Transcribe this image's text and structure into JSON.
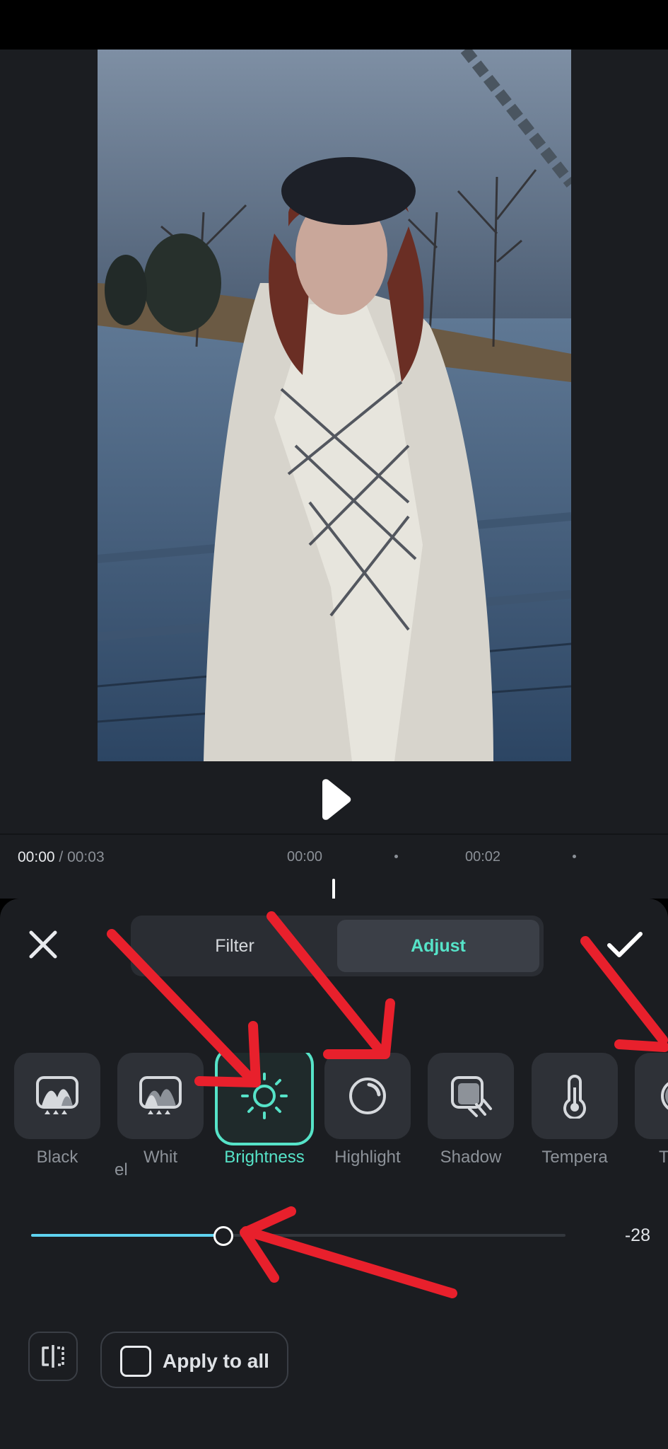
{
  "timeline": {
    "current": "00:00",
    "separator": " / ",
    "total": "00:03",
    "ticks": [
      "00:00",
      "00:02"
    ]
  },
  "tabs": {
    "filter": "Filter",
    "adjust": "Adjust",
    "selected": "Adjust"
  },
  "tools": [
    {
      "label": "el",
      "icon": "levels-icon"
    },
    {
      "label": "Black",
      "icon": "black-point-icon"
    },
    {
      "label": "el",
      "icon": "levels-icon"
    },
    {
      "label": "Whit",
      "icon": "white-point-icon"
    },
    {
      "label": "Brightness",
      "icon": "sun-icon",
      "selected": true
    },
    {
      "label": "Highlight",
      "icon": "highlight-icon"
    },
    {
      "label": "Shadow",
      "icon": "shadow-icon"
    },
    {
      "label": "Tempera",
      "icon": "thermometer-icon"
    },
    {
      "label": "T",
      "icon": "tint-icon"
    }
  ],
  "slider": {
    "value": "-28",
    "min": -100,
    "max": 100,
    "level": -28
  },
  "apply_to_all": {
    "label": "Apply to all",
    "checked": false
  },
  "colors": {
    "accent": "#56e3c8",
    "slider_fill": "#5fd3f0",
    "panel_bg": "#1b1d21",
    "annotation_arrow": "#e8202c"
  }
}
